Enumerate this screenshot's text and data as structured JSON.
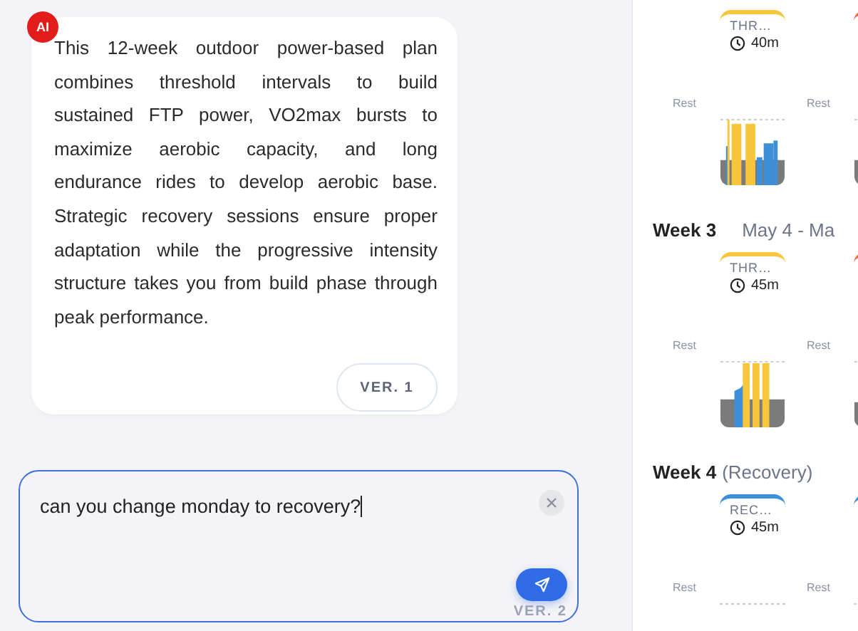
{
  "message": {
    "badge": "AI",
    "text": "This 12-week outdoor power-based plan combines threshold intervals to build sustained FTP power, VO2max bursts to maximize aerobic capacity, and long endurance rides to develop aerobic base. Strategic recovery sessions ensure proper adaptation while the progressive intensity structure takes you from build phase through peak performance.",
    "version": "VER. 1"
  },
  "composer": {
    "value": "can you change monday to recovery?",
    "version": "VER. 2"
  },
  "weeks": [
    {
      "workouts": [
        {
          "kind": "empty"
        },
        {
          "kind": "workout",
          "color": "#f7c63c",
          "label": "THR…",
          "duration": "40m"
        },
        {
          "kind": "empty"
        },
        {
          "kind": "workout",
          "color": "#ec6a3f"
        }
      ],
      "rests": [
        {
          "kind": "rest",
          "label": "Rest"
        },
        {
          "kind": "empty"
        },
        {
          "kind": "rest",
          "label": "Rest"
        },
        {
          "kind": "empty"
        }
      ],
      "profiles": [
        {
          "kind": "empty"
        },
        {
          "kind": "threshold"
        },
        {
          "kind": "empty"
        },
        {
          "kind": "threshold"
        }
      ]
    },
    {
      "title": "Week 3",
      "dates": "May 4 - Ma",
      "workouts": [
        {
          "kind": "empty"
        },
        {
          "kind": "workout",
          "color": "#f7c63c",
          "label": "THR…",
          "duration": "45m"
        },
        {
          "kind": "empty"
        },
        {
          "kind": "workout",
          "color": "#ec6a3f"
        }
      ],
      "rests": [
        {
          "kind": "rest",
          "label": "Rest"
        },
        {
          "kind": "empty"
        },
        {
          "kind": "rest",
          "label": "Rest"
        },
        {
          "kind": "empty"
        }
      ],
      "profiles": [
        {
          "kind": "empty"
        },
        {
          "kind": "ramp"
        },
        {
          "kind": "empty"
        },
        {
          "kind": "threshold"
        }
      ]
    },
    {
      "title": "Week 4",
      "note": "(Recovery)",
      "workouts": [
        {
          "kind": "empty"
        },
        {
          "kind": "workout",
          "color": "#3d8fd8",
          "label": "REC…",
          "duration": "45m"
        },
        {
          "kind": "empty"
        },
        {
          "kind": "workout",
          "color": "#3d8fd8"
        }
      ],
      "rests": [
        {
          "kind": "rest",
          "label": "Rest"
        },
        {
          "kind": "empty"
        },
        {
          "kind": "rest",
          "label": "Rest"
        },
        {
          "kind": "empty"
        }
      ],
      "profiles": [
        {
          "kind": "empty"
        },
        {
          "kind": "recovery"
        },
        {
          "kind": "empty"
        },
        {
          "kind": "recovery"
        }
      ]
    }
  ]
}
